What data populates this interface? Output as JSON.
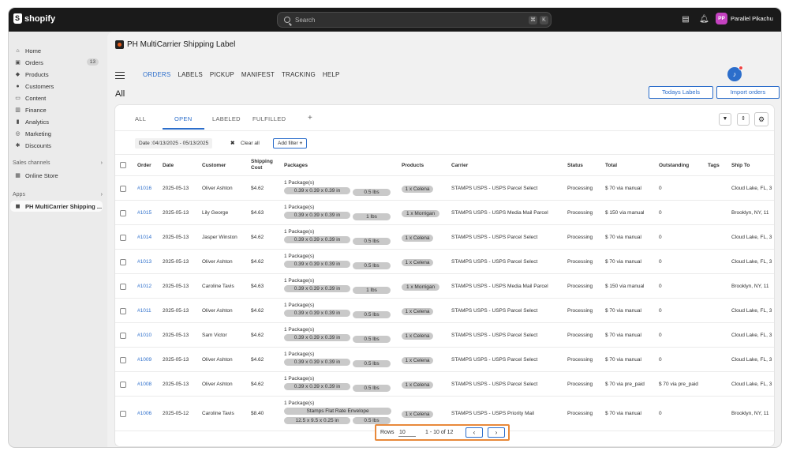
{
  "topbar": {
    "brand": "shopify",
    "search_placeholder": "Search",
    "shortcut_keys": [
      "⌘",
      "K"
    ],
    "user_initials": "PP",
    "user_name": "Parallel Pikachu"
  },
  "sidebar": {
    "items": [
      {
        "label": "Home",
        "icon": "home-icon"
      },
      {
        "label": "Orders",
        "icon": "orders-icon",
        "badge": "13"
      },
      {
        "label": "Products",
        "icon": "tag-icon"
      },
      {
        "label": "Customers",
        "icon": "person-icon"
      },
      {
        "label": "Content",
        "icon": "content-icon"
      },
      {
        "label": "Finance",
        "icon": "bank-icon"
      },
      {
        "label": "Analytics",
        "icon": "chart-bar-icon"
      },
      {
        "label": "Marketing",
        "icon": "target-icon"
      },
      {
        "label": "Discounts",
        "icon": "discount-icon"
      }
    ],
    "sales_channels_label": "Sales channels",
    "online_store": "Online Store",
    "apps_label": "Apps",
    "app_item": "PH MultiCarrier Shipping ..."
  },
  "app": {
    "title": "PH MultiCarrier Shipping Label",
    "nav": [
      "ORDERS",
      "LABELS",
      "PICKUP",
      "MANIFEST",
      "TRACKING",
      "HELP"
    ],
    "active_nav": "ORDERS",
    "notification_count": "1",
    "page_heading": "All",
    "todays_labels": "Todays Labels",
    "import_orders": "Import orders"
  },
  "tabs": [
    "ALL",
    "OPEN",
    "LABELED",
    "FULFILLED",
    "+"
  ],
  "active_tab": "OPEN",
  "filters": {
    "date_chip": "Date :04/13/2025 - 05/13/2025",
    "clear_all": "Clear all",
    "add_filter": "Add filter"
  },
  "columns": [
    "Order",
    "Date",
    "Customer",
    "Shipping Cost",
    "Packages",
    "Products",
    "Carrier",
    "Status",
    "Total",
    "Outstanding",
    "Tags",
    "Ship To"
  ],
  "rows": [
    {
      "order": "#1016",
      "date": "2025-05-13",
      "customer": "Oliver Ashton",
      "cost": "$4.62",
      "pkg_count": "1 Package(s)",
      "dims": "0.39 x 0.39 x 0.39 in",
      "weight": "0.5 lbs",
      "product": "1 x Celena",
      "carrier": "STAMPS USPS - USPS Parcel Select",
      "status": "Processing",
      "total": "$ 70 via manual",
      "outstanding": "0",
      "ship_to": "Cloud Lake, FL, 3"
    },
    {
      "order": "#1015",
      "date": "2025-05-13",
      "customer": "Lily George",
      "cost": "$4.63",
      "pkg_count": "1 Package(s)",
      "dims": "0.39 x 0.39 x 0.39 in",
      "weight": "1 lbs",
      "product": "1 x Morrigan",
      "carrier": "STAMPS USPS - USPS Media Mail Parcel",
      "status": "Processing",
      "total": "$ 150 via manual",
      "outstanding": "0",
      "ship_to": "Brooklyn, NY, 11"
    },
    {
      "order": "#1014",
      "date": "2025-05-13",
      "customer": "Jasper Winston",
      "cost": "$4.62",
      "pkg_count": "1 Package(s)",
      "dims": "0.39 x 0.39 x 0.39 in",
      "weight": "0.5 lbs",
      "product": "1 x Celena",
      "carrier": "STAMPS USPS - USPS Parcel Select",
      "status": "Processing",
      "total": "$ 70 via manual",
      "outstanding": "0",
      "ship_to": "Cloud Lake, FL, 3"
    },
    {
      "order": "#1013",
      "date": "2025-05-13",
      "customer": "Oliver Ashton",
      "cost": "$4.62",
      "pkg_count": "1 Package(s)",
      "dims": "0.39 x 0.39 x 0.39 in",
      "weight": "0.5 lbs",
      "product": "1 x Celena",
      "carrier": "STAMPS USPS - USPS Parcel Select",
      "status": "Processing",
      "total": "$ 70 via manual",
      "outstanding": "0",
      "ship_to": "Cloud Lake, FL, 3"
    },
    {
      "order": "#1012",
      "date": "2025-05-13",
      "customer": "Caroline Tavis",
      "cost": "$4.63",
      "pkg_count": "1 Package(s)",
      "dims": "0.39 x 0.39 x 0.39 in",
      "weight": "1 lbs",
      "product": "1 x Morrigan",
      "carrier": "STAMPS USPS - USPS Media Mail Parcel",
      "status": "Processing",
      "total": "$ 150 via manual",
      "outstanding": "0",
      "ship_to": "Brooklyn, NY, 11"
    },
    {
      "order": "#1011",
      "date": "2025-05-13",
      "customer": "Oliver Ashton",
      "cost": "$4.62",
      "pkg_count": "1 Package(s)",
      "dims": "0.39 x 0.39 x 0.39 in",
      "weight": "0.5 lbs",
      "product": "1 x Celena",
      "carrier": "STAMPS USPS - USPS Parcel Select",
      "status": "Processing",
      "total": "$ 70 via manual",
      "outstanding": "0",
      "ship_to": "Cloud Lake, FL, 3"
    },
    {
      "order": "#1010",
      "date": "2025-05-13",
      "customer": "Sam Victor",
      "cost": "$4.62",
      "pkg_count": "1 Package(s)",
      "dims": "0.39 x 0.39 x 0.39 in",
      "weight": "0.5 lbs",
      "product": "1 x Celena",
      "carrier": "STAMPS USPS - USPS Parcel Select",
      "status": "Processing",
      "total": "$ 70 via manual",
      "outstanding": "0",
      "ship_to": "Cloud Lake, FL, 3"
    },
    {
      "order": "#1009",
      "date": "2025-05-13",
      "customer": "Oliver Ashton",
      "cost": "$4.62",
      "pkg_count": "1 Package(s)",
      "dims": "0.39 x 0.39 x 0.39 in",
      "weight": "0.5 lbs",
      "product": "1 x Celena",
      "carrier": "STAMPS USPS - USPS Parcel Select",
      "status": "Processing",
      "total": "$ 70 via manual",
      "outstanding": "0",
      "ship_to": "Cloud Lake, FL, 3"
    },
    {
      "order": "#1008",
      "date": "2025-05-13",
      "customer": "Oliver Ashton",
      "cost": "$4.62",
      "pkg_count": "1 Package(s)",
      "dims": "0.39 x 0.39 x 0.39 in",
      "weight": "0.5 lbs",
      "product": "1 x Celena",
      "carrier": "STAMPS USPS - USPS Parcel Select",
      "status": "Processing",
      "total": "$ 70 via pre_paid",
      "outstanding": "$ 70 via pre_paid",
      "ship_to": "Cloud Lake, FL, 3"
    },
    {
      "order": "#1006",
      "date": "2025-05-12",
      "customer": "Caroline Tavis",
      "cost": "$8.40",
      "pkg_count": "1 Package(s)",
      "package_type": "Stamps Flat Rate Envelope",
      "dims": "12.5 x 9.5 x 0.25 in",
      "weight": "0.5 lbs",
      "product": "1 x Celena",
      "carrier": "STAMPS USPS - USPS Priority Mail",
      "status": "Processing",
      "total": "$ 70 via manual",
      "outstanding": "0",
      "ship_to": "Brooklyn, NY, 11"
    }
  ],
  "pagination": {
    "rows_label": "Rows",
    "rows_value": "10",
    "range": "1 - 10 of 12",
    "prev": "‹",
    "next": "›"
  },
  "colors": {
    "accent": "#2c6ecb",
    "topbar": "#1a1a1a",
    "highlight": "#e8893a",
    "pill": "#c9c9c9"
  }
}
